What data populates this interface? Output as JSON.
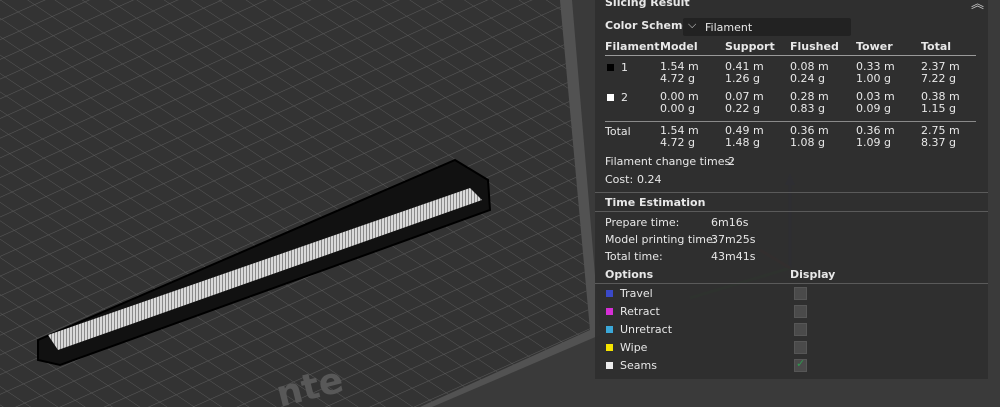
{
  "viewport": {
    "plate_label": "nte"
  },
  "panel": {
    "title": "Slicing Result",
    "collapse_icon": "double-chevron-up-icon",
    "color_scheme": {
      "label": "Color Scheme",
      "value": "Filament",
      "icon": "chevron-down-icon"
    },
    "table": {
      "headers": [
        "Filament",
        "Model",
        "Support",
        "Flushed",
        "Tower",
        "Total"
      ],
      "rows": [
        {
          "id": "1",
          "swatch": "#000000",
          "model": [
            "1.54 m",
            "4.72 g"
          ],
          "support": [
            "0.41 m",
            "1.26 g"
          ],
          "flushed": [
            "0.08 m",
            "0.24 g"
          ],
          "tower": [
            "0.33 m",
            "1.00 g"
          ],
          "total": [
            "2.37 m",
            "7.22 g"
          ]
        },
        {
          "id": "2",
          "swatch": "#ffffff",
          "model": [
            "0.00 m",
            "0.00 g"
          ],
          "support": [
            "0.07 m",
            "0.22 g"
          ],
          "flushed": [
            "0.28 m",
            "0.83 g"
          ],
          "tower": [
            "0.03 m",
            "0.09 g"
          ],
          "total": [
            "0.38 m",
            "1.15 g"
          ]
        }
      ],
      "total_row": {
        "label": "Total",
        "model": [
          "1.54 m",
          "4.72 g"
        ],
        "support": [
          "0.49 m",
          "1.48 g"
        ],
        "flushed": [
          "0.36 m",
          "1.08 g"
        ],
        "tower": [
          "0.36 m",
          "1.09 g"
        ],
        "total": [
          "2.75 m",
          "8.37 g"
        ]
      }
    },
    "filament_change": {
      "label": "Filament change times:",
      "value": "2"
    },
    "cost": {
      "label": "Cost:",
      "value": "0.24"
    },
    "time_estimation": {
      "title": "Time Estimation",
      "rows": [
        {
          "label": "Prepare time:",
          "value": "6m16s"
        },
        {
          "label": "Model printing time:",
          "value": "37m25s"
        },
        {
          "label": "Total time:",
          "value": "43m41s"
        }
      ]
    },
    "options": {
      "title": "Options",
      "display_title": "Display",
      "items": [
        {
          "label": "Travel",
          "color": "#3a49c8",
          "checked": false
        },
        {
          "label": "Retract",
          "color": "#d62fd6",
          "checked": false
        },
        {
          "label": "Unretract",
          "color": "#3ba8d8",
          "checked": false
        },
        {
          "label": "Wipe",
          "color": "#f5e400",
          "checked": false
        },
        {
          "label": "Seams",
          "color": "#ececec",
          "checked": true
        }
      ]
    }
  }
}
